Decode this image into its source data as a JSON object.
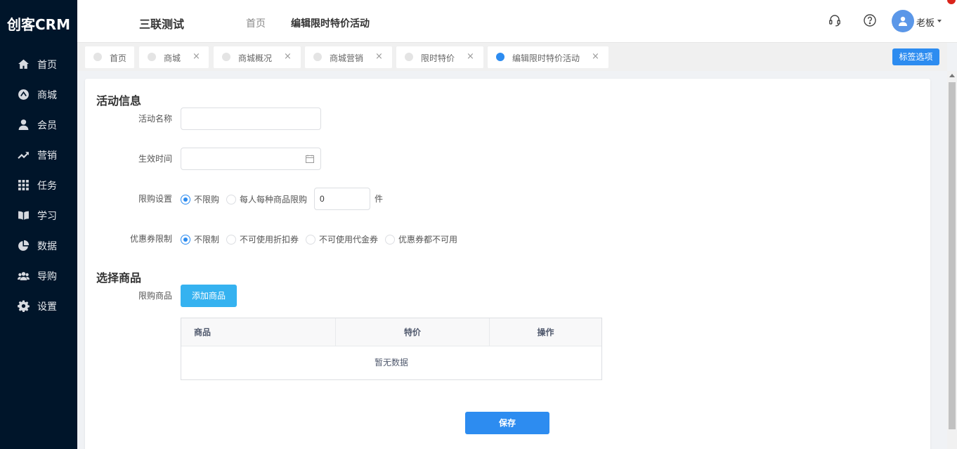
{
  "app": {
    "logo": "创客CRM"
  },
  "sidebar": {
    "items": [
      {
        "label": "首页",
        "icon": "home-icon"
      },
      {
        "label": "商城",
        "icon": "mall-icon"
      },
      {
        "label": "会员",
        "icon": "user-icon"
      },
      {
        "label": "营销",
        "icon": "trend-icon"
      },
      {
        "label": "任务",
        "icon": "grid-icon"
      },
      {
        "label": "学习",
        "icon": "book-icon"
      },
      {
        "label": "数据",
        "icon": "pie-icon"
      },
      {
        "label": "导购",
        "icon": "group-icon"
      },
      {
        "label": "设置",
        "icon": "gear-icon"
      }
    ]
  },
  "header": {
    "store_name": "三联测试",
    "breadcrumb_home": "首页",
    "breadcrumb_current": "编辑限时特价活动",
    "user_name": "老板"
  },
  "tabs": {
    "items": [
      {
        "label": "首页",
        "closable": false,
        "active": false
      },
      {
        "label": "商城",
        "closable": true,
        "active": false
      },
      {
        "label": "商城概况",
        "closable": true,
        "active": false
      },
      {
        "label": "商城营销",
        "closable": true,
        "active": false
      },
      {
        "label": "限时特价",
        "closable": true,
        "active": false
      },
      {
        "label": "编辑限时特价活动",
        "closable": true,
        "active": true
      }
    ],
    "close_symbol": "×",
    "options_label": "标签选项"
  },
  "form": {
    "section_activity": "活动信息",
    "name_label": "活动名称",
    "name_value": "",
    "time_label": "生效时间",
    "time_value": "",
    "limit_label": "限购设置",
    "limit_options": [
      "不限购",
      "每人每种商品限购"
    ],
    "limit_selected": 0,
    "limit_quantity": "0",
    "limit_unit": "件",
    "coupon_label": "优惠券限制",
    "coupon_options": [
      "不限制",
      "不可使用折扣券",
      "不可使用代金券",
      "优惠券都不可用"
    ],
    "coupon_selected": 0,
    "section_goods": "选择商品",
    "goods_label": "限购商品",
    "add_goods_button": "添加商品",
    "table_headers": [
      "商品",
      "特价",
      "操作"
    ],
    "empty_text": "暂无数据",
    "save_button": "保存"
  },
  "colors": {
    "primary": "#2d8cf0",
    "sidebar": "#00152a",
    "add_button": "#35b2f0"
  }
}
